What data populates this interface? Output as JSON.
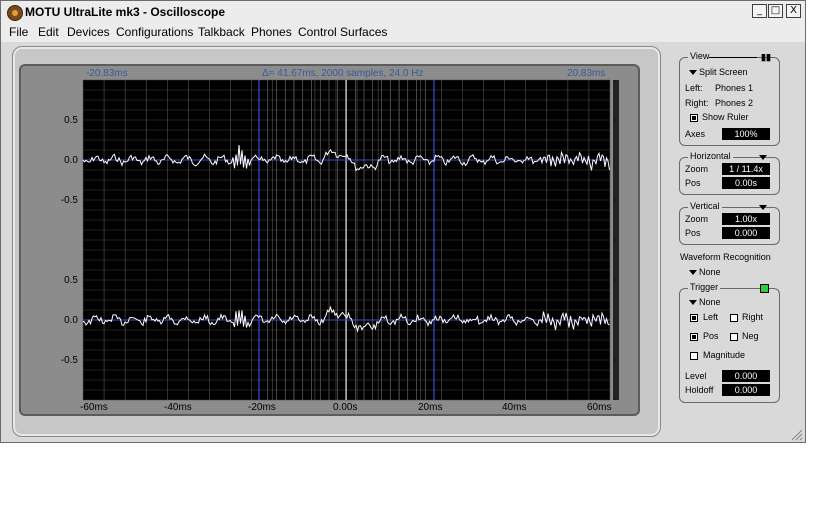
{
  "window": {
    "title": "MOTU UltraLite mk3 - Oscilloscope",
    "min": "_",
    "max": "□",
    "close": "X"
  },
  "menu": [
    "File",
    "Edit",
    "Devices",
    "Configurations",
    "Talkback",
    "Phones",
    "Control Surfaces"
  ],
  "scope": {
    "left_time": "-20.83ms",
    "delta": "Δ= 41.67ms, 2000 samples, 24.0 Hz",
    "right_time": "20.83ms",
    "y_labels_top": [
      "0.5",
      "0.0",
      "-0.5"
    ],
    "y_labels_bottom": [
      "0.5",
      "0.0",
      "-0.5"
    ],
    "x_labels": [
      "-60ms",
      "-40ms",
      "-20ms",
      "0.00s",
      "20ms",
      "40ms",
      "60ms"
    ]
  },
  "view": {
    "title": "View",
    "mode": "Split Screen",
    "left_label": "Left:",
    "left_value": "Phones 1",
    "right_label": "Right:",
    "right_value": "Phones 2",
    "show_ruler": "Show Ruler",
    "axes_label": "Axes",
    "axes_value": "100%"
  },
  "horizontal": {
    "title": "Horizontal",
    "zoom_label": "Zoom",
    "zoom_value": "1 / 11.4x",
    "pos_label": "Pos",
    "pos_value": "0.00s"
  },
  "vertical": {
    "title": "Vertical",
    "zoom_label": "Zoom",
    "zoom_value": "1.00x",
    "pos_label": "Pos",
    "pos_value": "0.000"
  },
  "waveform": {
    "title": "Waveform Recognition",
    "value": "None"
  },
  "trigger": {
    "title": "Trigger",
    "mode": "None",
    "left": "Left",
    "right": "Right",
    "pos": "Pos",
    "neg": "Neg",
    "magnitude": "Magnitude",
    "level_label": "Level",
    "level_value": "0.000",
    "holdoff_label": "Holdoff",
    "holdoff_value": "0.000"
  }
}
